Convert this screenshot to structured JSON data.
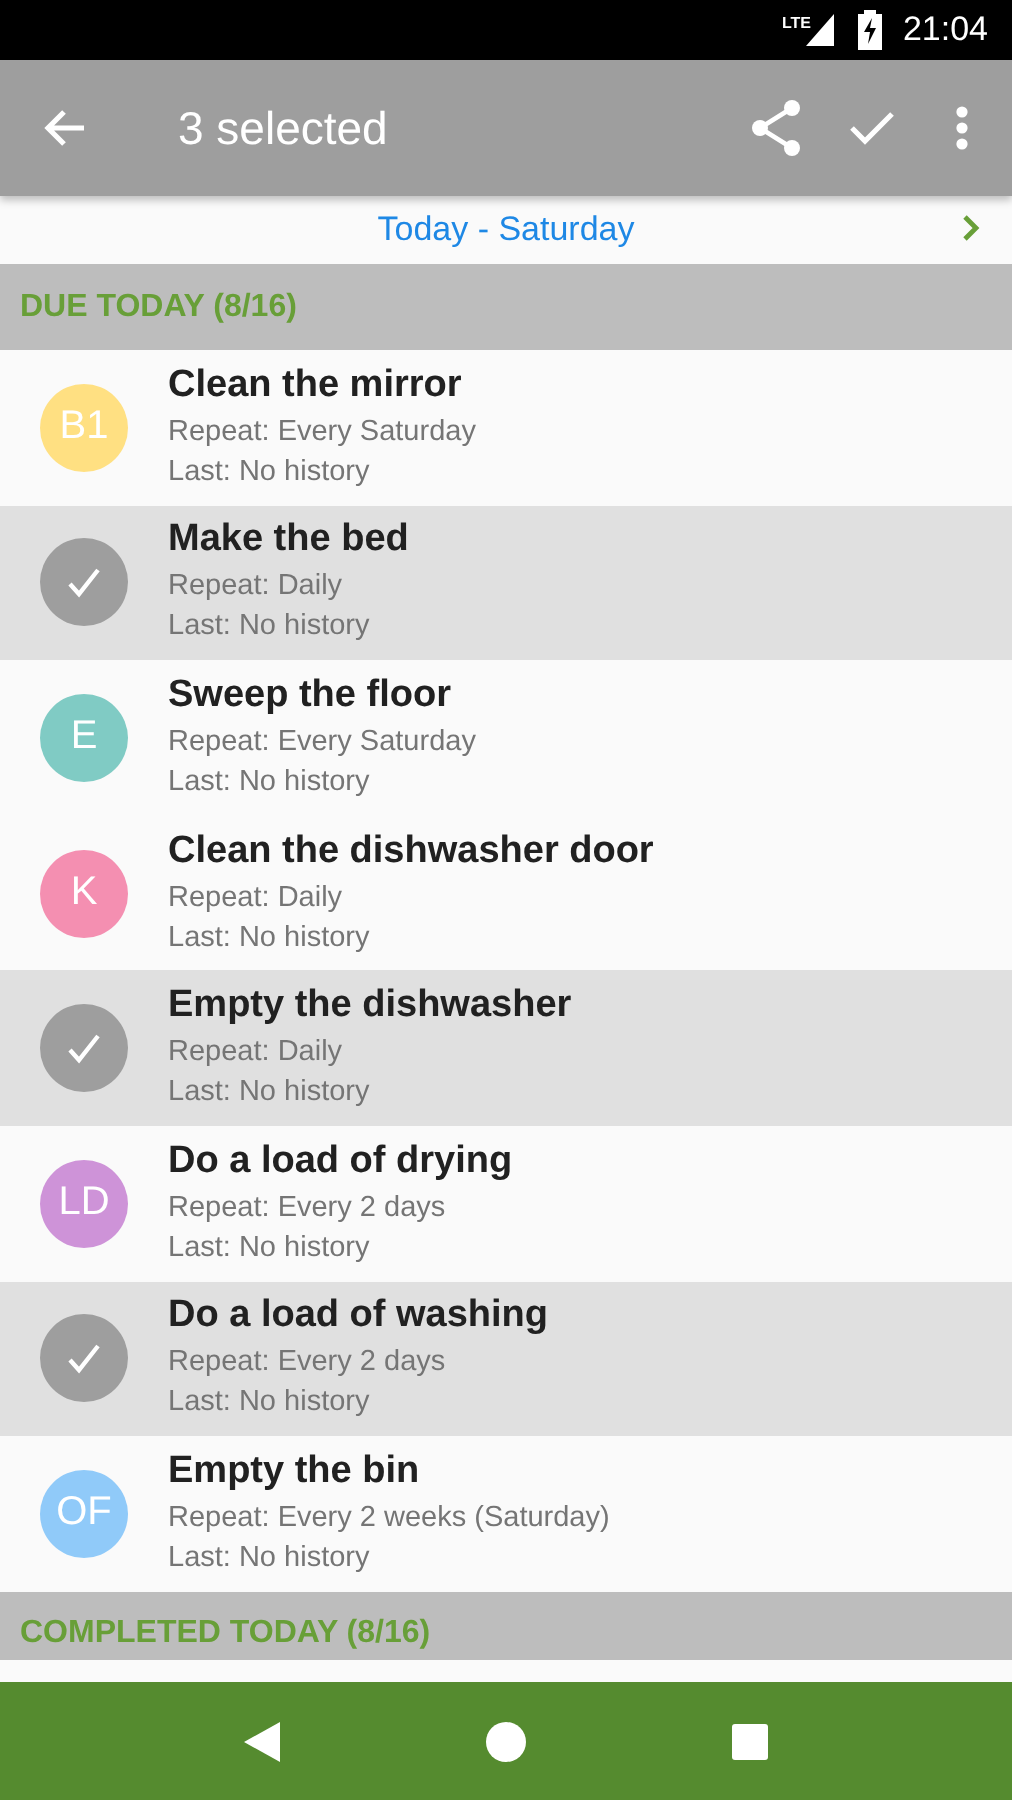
{
  "status_bar": {
    "network": "LTE",
    "time": "21:04"
  },
  "toolbar": {
    "title": "3 selected"
  },
  "date_bar": {
    "label": "Today - Saturday"
  },
  "sections": [
    {
      "title": "DUE TODAY (8/16)",
      "tasks": [
        {
          "name": "Clean the mirror",
          "repeat": "Repeat: Every Saturday",
          "last": "Last: No history",
          "selected": false,
          "initials": "B1",
          "color": "#ffe082"
        },
        {
          "name": "Make the bed",
          "repeat": "Repeat: Daily",
          "last": "Last: No history",
          "selected": true
        },
        {
          "name": "Sweep the floor",
          "repeat": "Repeat: Every Saturday",
          "last": "Last: No history",
          "selected": false,
          "initials": "E",
          "color": "#80cbc4"
        },
        {
          "name": "Clean the dishwasher door",
          "repeat": "Repeat: Daily",
          "last": "Last: No history",
          "selected": false,
          "initials": "K",
          "color": "#f48fb1"
        },
        {
          "name": "Empty the dishwasher",
          "repeat": "Repeat: Daily",
          "last": "Last: No history",
          "selected": true
        },
        {
          "name": "Do a load of drying",
          "repeat": "Repeat: Every 2 days",
          "last": "Last: No history",
          "selected": false,
          "initials": "LD",
          "color": "#ce93d8"
        },
        {
          "name": "Do a load of washing",
          "repeat": "Repeat: Every 2 days",
          "last": "Last: No history",
          "selected": true
        },
        {
          "name": "Empty the bin",
          "repeat": "Repeat: Every 2 weeks (Saturday)",
          "last": "Last: No history",
          "selected": false,
          "initials": "OF",
          "color": "#90caf9"
        }
      ]
    },
    {
      "title": "COMPLETED TODAY (8/16)"
    }
  ]
}
